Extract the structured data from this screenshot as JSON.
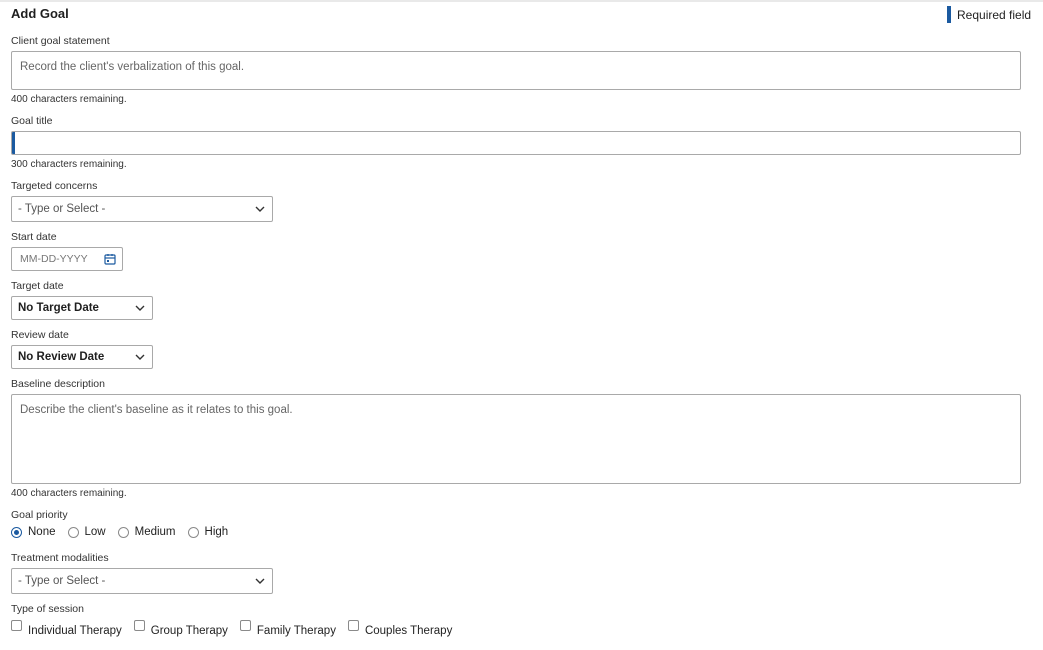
{
  "header": {
    "title": "Add Goal",
    "required_note": "Required field"
  },
  "client_goal_statement": {
    "label": "Client goal statement",
    "placeholder": "Record the client's verbalization of this goal.",
    "remaining": "400 characters remaining."
  },
  "goal_title": {
    "label": "Goal title",
    "value": "",
    "remaining": "300 characters remaining."
  },
  "targeted_concerns": {
    "label": "Targeted concerns",
    "value": "- Type or Select -"
  },
  "start_date": {
    "label": "Start date",
    "placeholder": "MM-DD-YYYY"
  },
  "target_date": {
    "label": "Target date",
    "value": "No Target Date"
  },
  "review_date": {
    "label": "Review date",
    "value": "No Review Date"
  },
  "baseline_description": {
    "label": "Baseline description",
    "placeholder": "Describe the client's baseline as it relates to this goal.",
    "remaining": "400 characters remaining."
  },
  "goal_priority": {
    "label": "Goal priority",
    "options": [
      "None",
      "Low",
      "Medium",
      "High"
    ],
    "selected": "None"
  },
  "treatment_modalities": {
    "label": "Treatment modalities",
    "value": "- Type or Select -"
  },
  "type_of_session": {
    "label": "Type of session",
    "options": [
      "Individual Therapy",
      "Group Therapy",
      "Family Therapy",
      "Couples Therapy"
    ]
  },
  "colors": {
    "accent": "#1b5aa0",
    "border": "#a9a9a9"
  },
  "icons": {
    "select": "chevron-down-icon",
    "date": "calendar-icon"
  }
}
